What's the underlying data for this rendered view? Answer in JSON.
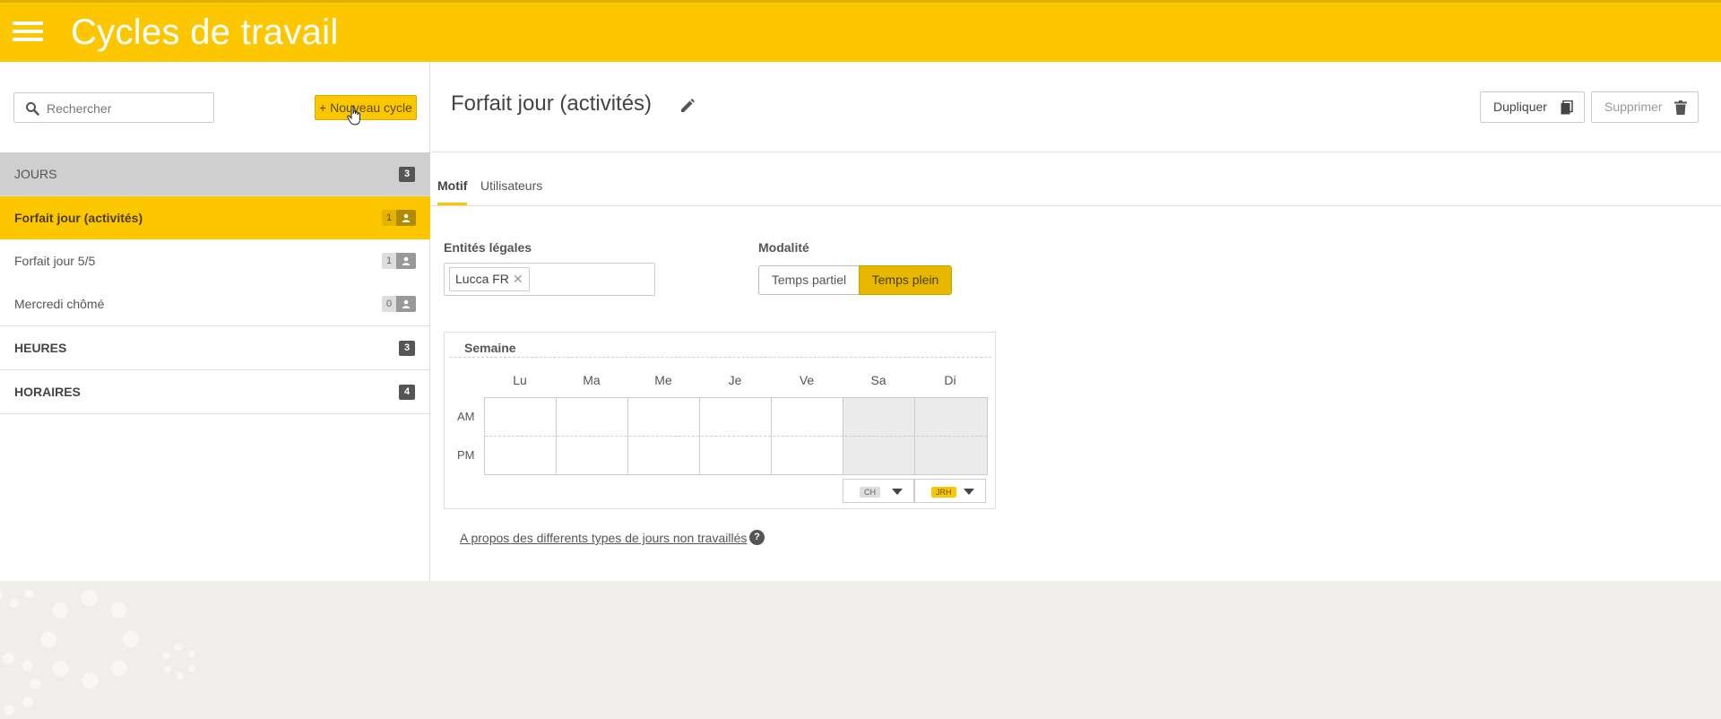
{
  "header": {
    "title": "Cycles de travail"
  },
  "sidebar": {
    "search_placeholder": "Rechercher",
    "new_button": "+ Nouveau cycle",
    "groups": [
      {
        "label": "JOURS",
        "count": "3"
      },
      {
        "label": "HEURES",
        "count": "3"
      },
      {
        "label": "HORAIRES",
        "count": "4"
      }
    ],
    "items": [
      {
        "label": "Forfait jour (activités)",
        "users": "1"
      },
      {
        "label": "Forfait jour 5/5",
        "users": "1"
      },
      {
        "label": "Mercredi chômé",
        "users": "0"
      }
    ]
  },
  "detail": {
    "title": "Forfait jour (activités)",
    "duplicate_label": "Dupliquer",
    "delete_label": "Supprimer",
    "tabs": [
      "Motif",
      "Utilisateurs"
    ],
    "entities_label": "Entités légales",
    "entity_tag": "Lucca FR",
    "modality_label": "Modalité",
    "modality_options": [
      "Temps partiel",
      "Temps plein"
    ],
    "modality_selected": "Temps plein",
    "week": {
      "title": "Semaine",
      "days": [
        "Lu",
        "Ma",
        "Me",
        "Je",
        "Ve",
        "Sa",
        "Di"
      ],
      "rows": [
        "AM",
        "PM"
      ],
      "saturday_code": "CH",
      "sunday_code": "JRH"
    },
    "info_link": "A propos des differents types de jours non travaillés",
    "help_icon": "?"
  },
  "colors": {
    "accent": "#fdc700",
    "accent_dark": "#e8b700",
    "background": "#f0eeea"
  }
}
